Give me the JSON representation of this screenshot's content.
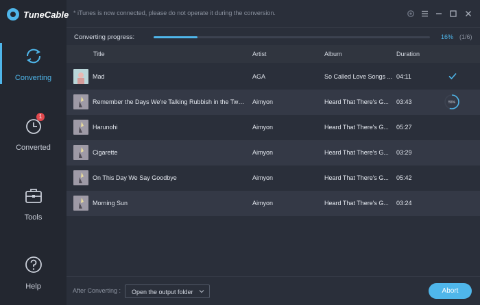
{
  "app": {
    "name": "TuneCable"
  },
  "notice": "iTunes is now connected, please do not operate it during the conversion.",
  "window_controls": [
    "settings-icon",
    "menu-icon",
    "minimize-icon",
    "maximize-icon",
    "close-icon"
  ],
  "sidebar": {
    "items": [
      {
        "label": "Converting",
        "icon": "converting-icon",
        "active": true
      },
      {
        "label": "Converted",
        "icon": "clock-icon",
        "badge": "1"
      },
      {
        "label": "Tools",
        "icon": "toolbox-icon"
      },
      {
        "label": "Help",
        "icon": "help-icon"
      }
    ]
  },
  "progress": {
    "label": "Converting progress:",
    "percent": "16%",
    "count": "(1/6)",
    "fraction": 0.16
  },
  "table": {
    "headers": {
      "title": "Title",
      "artist": "Artist",
      "album": "Album",
      "duration": "Duration"
    },
    "rows": [
      {
        "title": "Mad",
        "artist": "AGA",
        "album": "So Called Love Songs ...",
        "duration": "04:11",
        "status": "done"
      },
      {
        "title": "Remember the Days We're Talking Rubbish in the Twili...",
        "artist": "Aimyon",
        "album": "Heard That There's G...",
        "duration": "03:43",
        "status": "converting",
        "progress": "55%"
      },
      {
        "title": "Harunohi",
        "artist": "Aimyon",
        "album": "Heard That There's G...",
        "duration": "05:27",
        "status": "pending"
      },
      {
        "title": "Cigarette",
        "artist": "Aimyon",
        "album": "Heard That There's G...",
        "duration": "03:29",
        "status": "pending"
      },
      {
        "title": "On This Day We Say Goodbye",
        "artist": "Aimyon",
        "album": "Heard That There's G...",
        "duration": "05:42",
        "status": "pending"
      },
      {
        "title": "Morning Sun",
        "artist": "Aimyon",
        "album": "Heard That There's G...",
        "duration": "03:24",
        "status": "pending"
      }
    ]
  },
  "footer": {
    "after_label": "After Converting :",
    "after_value": "Open the output folder",
    "abort_label": "Abort"
  },
  "colors": {
    "accent": "#4fb6ea",
    "badge": "#e2484d",
    "background": "#2a2f3a",
    "sidebar": "#232730"
  }
}
